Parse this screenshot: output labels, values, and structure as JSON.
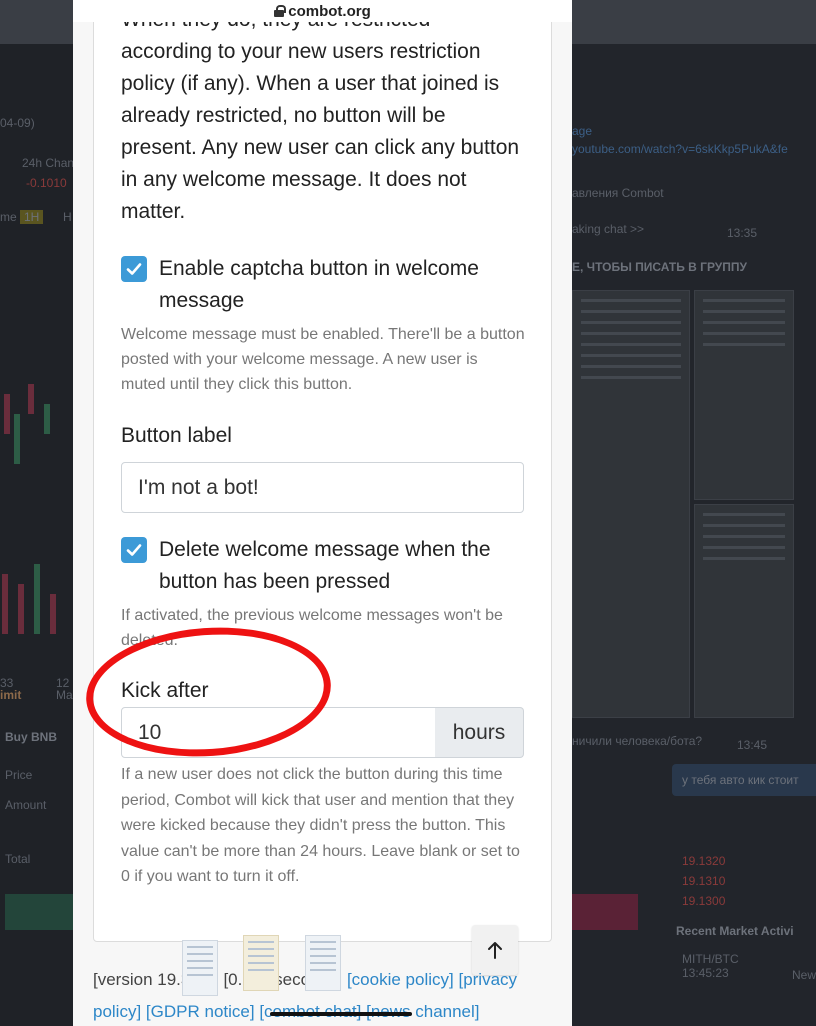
{
  "browser": {
    "url": "combot.org"
  },
  "intro_text": "When they do, they are restricted according to your new users restriction policy (if any). When a user that joined is already restricted, no button will be present. Any new user can click any button in any welcome message. It does not matter.",
  "captcha": {
    "checked": true,
    "label": "Enable captcha button in welcome message",
    "help": "Welcome message must be enabled. There'll be a button posted with your welcome message. A new user is muted until they click this button."
  },
  "button_label": {
    "label": "Button label",
    "value": "I'm not a bot!"
  },
  "delete_welcome": {
    "checked": true,
    "label": "Delete welcome message when the button has been pressed",
    "help": "If activated, the previous welcome messages won't be deleted."
  },
  "kick_after": {
    "label": "Kick after",
    "value": "10",
    "unit": "hours",
    "help": "If a new user does not click the button during this time period, Combot will kick that user and mention that they were kicked because they didn't press the button. This value can't be more than 24 hours. Leave blank or set to 0 if you want to turn it off."
  },
  "footer": {
    "version": "[version 19.3.31]",
    "time": "[0.011 seconds]",
    "links": [
      "[cookie policy]",
      "[privacy policy]",
      "[GDPR notice]",
      "[combot chat]",
      "[news channel]"
    ]
  },
  "background": {
    "left": [
      "04-09)",
      "24h Chan",
      "-0.1010",
      "me",
      "1H",
      "H",
      "33",
      "12",
      "imit",
      "Ma",
      "Buy BNB",
      "Price",
      "Amount",
      "Total"
    ],
    "right": [
      "age",
      "youtube.com/watch?v=6skKkp5PukA&fe",
      "авления Combot",
      "aking chat >>",
      "13:35",
      "Е, ЧТОБЫ ПИСАТЬ В ГРУППУ",
      "ничили человека/бота?",
      "13:45",
      "у тебя авто кик стоит",
      "19.1320",
      "19.1310",
      "19.1300",
      "Recent Market Activi",
      "MITH/BTC",
      "13:45:23",
      "New"
    ]
  },
  "colors": {
    "accent": "#3c9ad7",
    "annotation": "#ee1212",
    "link": "#2d87c8"
  }
}
